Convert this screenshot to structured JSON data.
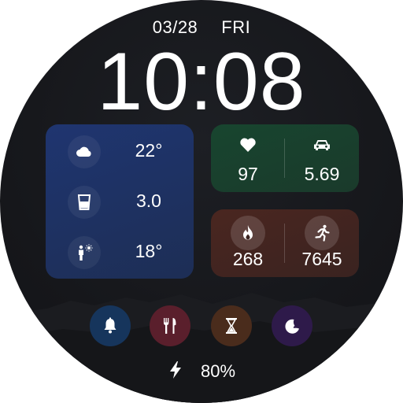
{
  "date": {
    "day": "03/28",
    "weekday": "FRI"
  },
  "time": "10:08",
  "weather_card": {
    "temperature": "22°",
    "water": "3.0",
    "uv_temp": "18°",
    "icons": [
      "cloud-icon",
      "water-glass-icon",
      "person-sun-icon"
    ]
  },
  "health_card": {
    "heart_rate": "97",
    "distance": "5.69",
    "icons": [
      "heart-icon",
      "car-icon"
    ]
  },
  "activity_card": {
    "calories": "268",
    "steps": "7645",
    "icons": [
      "flame-icon",
      "running-icon"
    ]
  },
  "shortcuts": [
    {
      "name": "alarm",
      "icon": "bell-icon",
      "color": "#16355c"
    },
    {
      "name": "meal",
      "icon": "fork-knife-icon",
      "color": "#5a1f2c"
    },
    {
      "name": "timer",
      "icon": "hourglass-icon",
      "color": "#4a2c1c"
    },
    {
      "name": "sleep",
      "icon": "moon-sleep-icon",
      "color": "#2e1a4a"
    }
  ],
  "battery": {
    "level": "80%",
    "icon": "lightning-icon"
  },
  "colors": {
    "weather_card": "#1f3570",
    "health_card": "#18452f",
    "activity_card": "#4a2620"
  }
}
